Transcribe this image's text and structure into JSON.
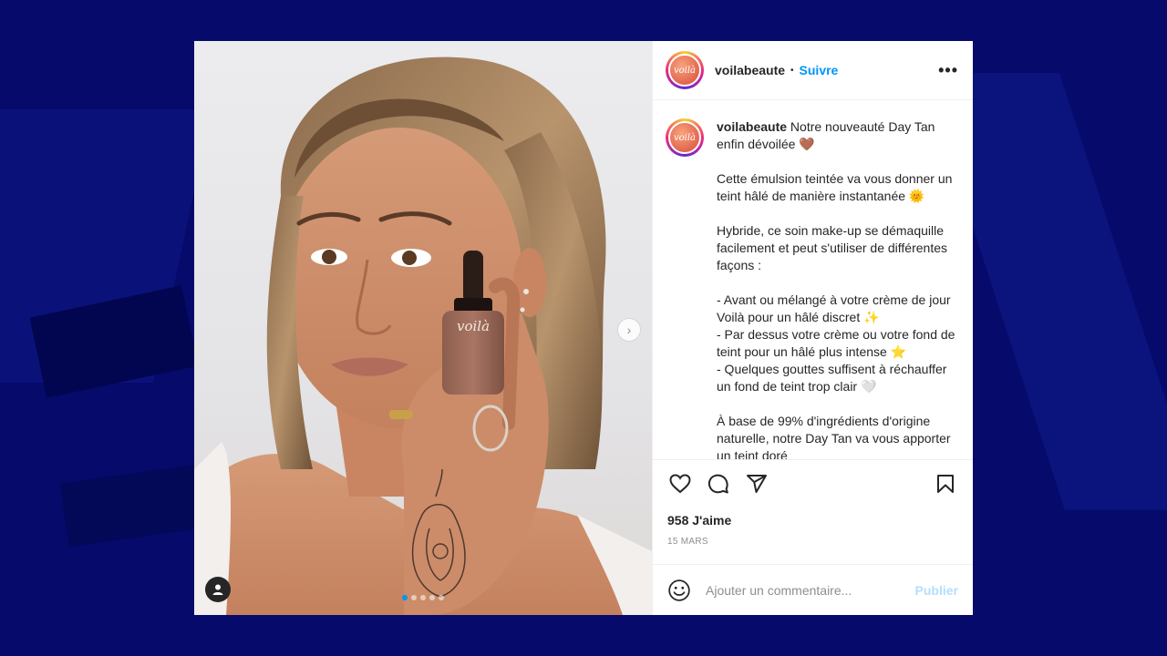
{
  "post": {
    "username": "voilabeaute",
    "separator": "•",
    "follow_label": "Suivre",
    "more_label": "•••",
    "avatar_text": "voilà",
    "next_label": "›",
    "carousel_count": 5,
    "carousel_active": 0
  },
  "caption": {
    "username": "voilabeaute",
    "lines": [
      "Notre nouveauté Day Tan enfin dévoilée 🤎",
      "Cette émulsion teintée va vous donner un teint hâlé de manière instantanée 🌞",
      "Hybride, ce soin make-up se démaquille facilement et peut s'utiliser de différentes façons :",
      "- Avant ou mélangé à votre crème de jour Voilà pour un hâlé discret ✨\n- Par dessus votre crème ou votre fond de teint pour un hâlé plus intense ⭐\n- Quelques gouttes suffisent à réchauffer un fond de teint trop clair 🤍",
      "À base de 99% d'ingrédients d'origine naturelle, notre Day Tan va vous apporter un teint doré"
    ]
  },
  "stats": {
    "likes": "958 J'aime",
    "date": "15 MARS"
  },
  "comment": {
    "placeholder": "Ajouter un commentaire...",
    "publish_label": "Publier"
  },
  "photo": {
    "bottle_label": "voilà"
  },
  "colors": {
    "accent": "#0095f6",
    "publish_disabled": "#b2dffc",
    "background": "#050a6b"
  }
}
